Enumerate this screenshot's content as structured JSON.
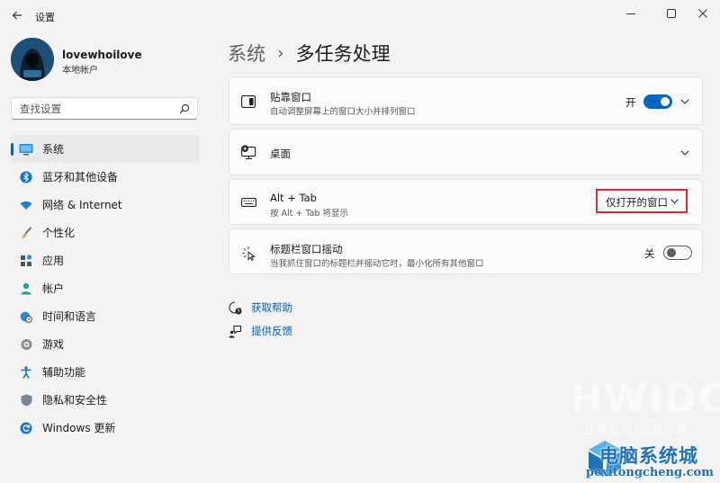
{
  "window": {
    "title": "设置",
    "controls": [
      "minimize-icon",
      "maximize-icon",
      "close-icon"
    ]
  },
  "profile": {
    "username": "lovewhoilove",
    "account_type": "本地帐户"
  },
  "search": {
    "placeholder": "查找设置",
    "value": ""
  },
  "sidebar": {
    "items": [
      {
        "label": "系统",
        "icon": "monitor-icon",
        "active": true
      },
      {
        "label": "蓝牙和其他设备",
        "icon": "bluetooth-icon"
      },
      {
        "label": "网络 & Internet",
        "icon": "wifi-icon"
      },
      {
        "label": "个性化",
        "icon": "brush-icon"
      },
      {
        "label": "应用",
        "icon": "apps-icon"
      },
      {
        "label": "帐户",
        "icon": "person-icon"
      },
      {
        "label": "时间和语言",
        "icon": "globe-clock-icon"
      },
      {
        "label": "游戏",
        "icon": "gamepad-icon"
      },
      {
        "label": "辅助功能",
        "icon": "accessibility-icon"
      },
      {
        "label": "隐私和安全性",
        "icon": "shield-icon"
      },
      {
        "label": "Windows 更新",
        "icon": "update-icon"
      }
    ]
  },
  "breadcrumb": {
    "parent": "系统",
    "separator": "›",
    "current": "多任务处理"
  },
  "settings": {
    "snap": {
      "title": "贴靠窗口",
      "description": "自动调整屏幕上的窗口大小并排列窗口",
      "toggle_label": "开",
      "enabled": true,
      "icon": "snap-windows-icon"
    },
    "desktops": {
      "title": "桌面",
      "icon": "desktop-add-icon"
    },
    "alt_tab": {
      "title": "Alt + Tab",
      "description": "按 Alt + Tab 将显示",
      "selected": "仅打开的窗口",
      "icon": "keyboard-icon"
    },
    "title_shake": {
      "title": "标题栏窗口摇动",
      "description": "当我抓住窗口的标题栏并摇动它时，最小化所有其他窗口",
      "toggle_label": "关",
      "enabled": false,
      "icon": "shake-icon"
    }
  },
  "links": {
    "help": "获取帮助",
    "feedback": "提供反馈"
  },
  "watermark": {
    "brand": "HWIDC",
    "sub": "至真至诚 品质保障",
    "site_name": "电脑系统城",
    "site_url": "pcxitongcheng.com"
  },
  "colors": {
    "accent": "#0067c0",
    "highlight_border": "#d92b2b",
    "link": "#0062b1"
  }
}
